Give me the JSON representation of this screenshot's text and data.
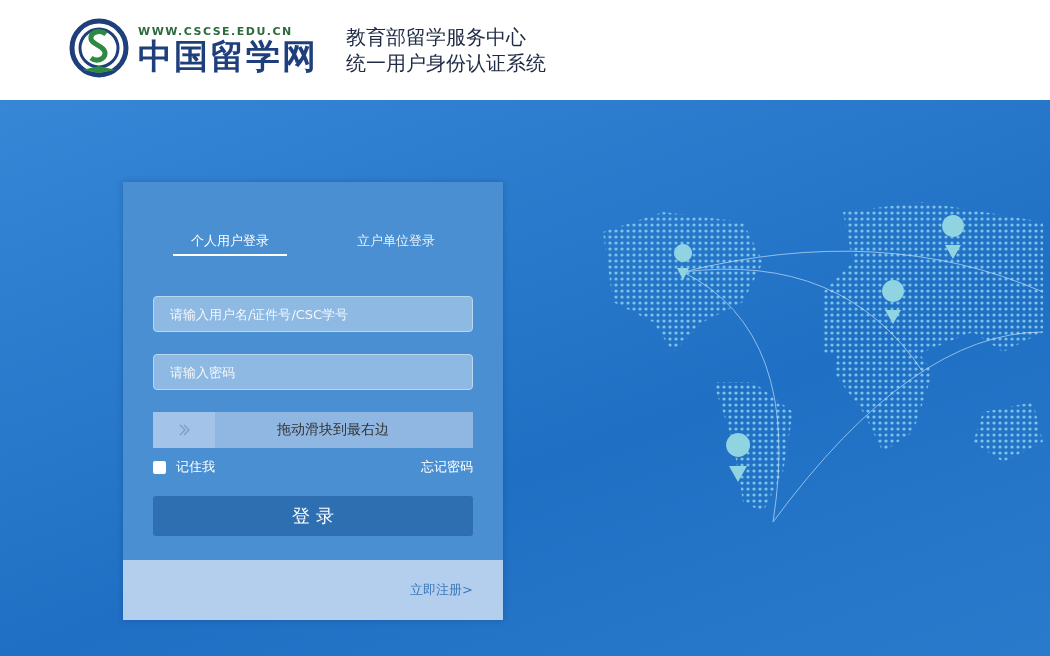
{
  "header": {
    "site_url": "WWW.CSCSE.EDU.CN",
    "site_name": "中国留学网",
    "title_lines": [
      "教育部留学服务中心",
      "统一用户身份认证系统"
    ]
  },
  "login": {
    "tabs": [
      {
        "label": "个人用户登录",
        "selected": true
      },
      {
        "label": "立户单位登录",
        "selected": false
      }
    ],
    "username": {
      "placeholder": "请输入用户名/证件号/CSC学号"
    },
    "password": {
      "placeholder": "请输入密码"
    },
    "slider": {
      "label": "拖动滑块到最右边",
      "level": 0
    },
    "remember": {
      "label": "记住我",
      "checked": false
    },
    "forgot_link": "忘记密码",
    "submit": "登 录",
    "register_link": "立即注册>"
  }
}
